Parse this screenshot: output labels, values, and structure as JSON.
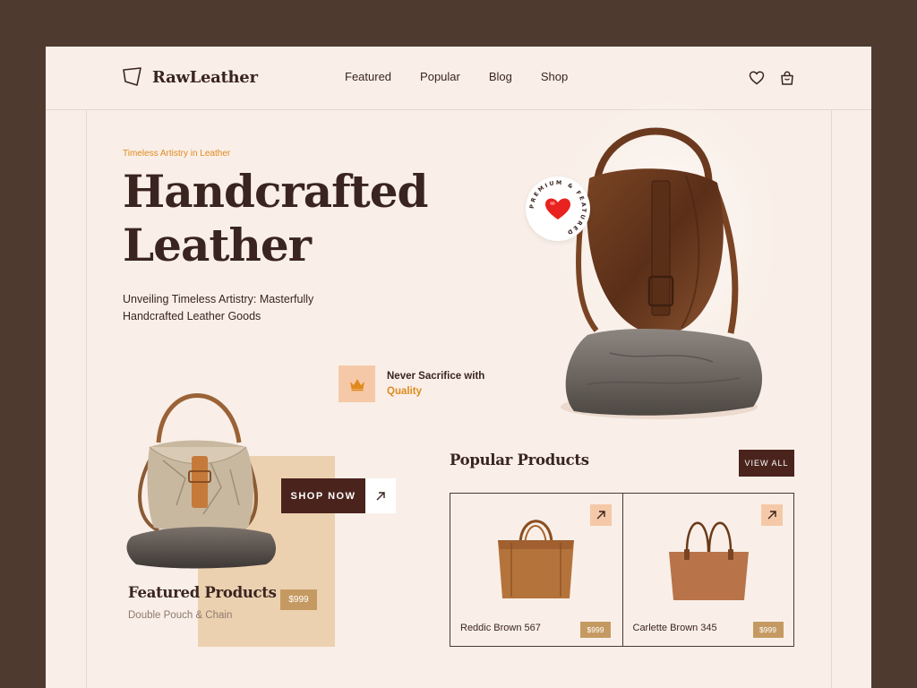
{
  "brand": {
    "name": "RawLeather"
  },
  "nav": {
    "items": [
      "Featured",
      "Popular",
      "Blog",
      "Shop"
    ]
  },
  "header_icons": [
    "heart-icon",
    "shopping-bag-icon"
  ],
  "hero": {
    "eyebrow": "Timeless Artistry in Leather",
    "title_line1": "Handcrafted",
    "title_line2": "Leather",
    "subtitle": "Unveiling Timeless Artistry: Masterfully Handcrafted Leather Goods",
    "badge_text": "PREMIUM & FEATURED"
  },
  "quality": {
    "line1": "Never Sacrifice with",
    "line2": "Quality",
    "icon": "crown-icon"
  },
  "featured": {
    "shop_now_label": "SHOP NOW",
    "title": "Featured Products",
    "subtitle": "Double Pouch & Chain",
    "price": "$999"
  },
  "popular": {
    "title": "Popular Products",
    "view_all_label": "VIEW ALL",
    "products": [
      {
        "name": "Reddic Brown 567",
        "price": "$999"
      },
      {
        "name": "Carlette Brown 345",
        "price": "$999"
      }
    ]
  },
  "colors": {
    "page_bg": "#f9efe8",
    "frame_bg": "#4f3a30",
    "dark_brown": "#4a231d",
    "accent_orange": "#e08a1e",
    "peach": "#f5c9a8",
    "tan": "#c59a62"
  }
}
